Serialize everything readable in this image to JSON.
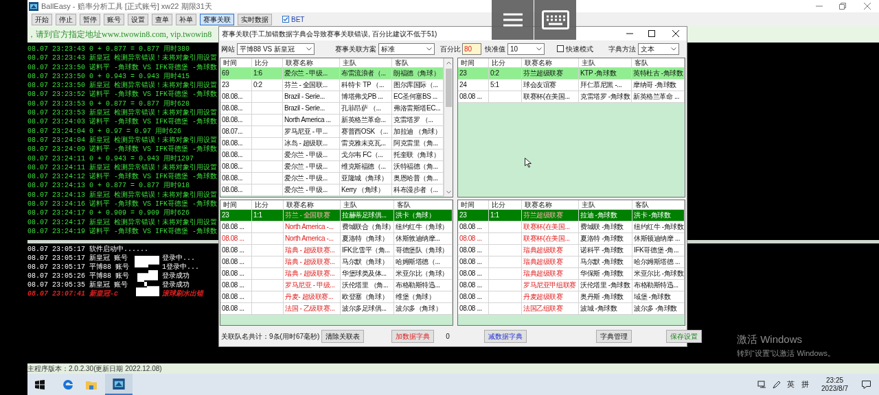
{
  "window": {
    "title": "BallEasy - 赔率分析工具 [正式账号] xw22 期限31天"
  },
  "toolbar": {
    "buttons": [
      {
        "label": "开始",
        "selected": false
      },
      {
        "label": "停止",
        "selected": false
      },
      {
        "label": "暂停",
        "selected": false
      },
      {
        "label": "账号",
        "selected": false
      },
      {
        "label": "设置",
        "selected": false
      },
      {
        "label": "查单",
        "selected": false
      },
      {
        "label": "补单",
        "selected": false
      },
      {
        "label": "赛事关联",
        "selected": true
      },
      {
        "label": "实时数据",
        "selected": false
      }
    ],
    "bet": {
      "label": "BET",
      "checked": true
    }
  },
  "banner": "，请到官方指定地址www.twowin8.com, vip.twowin8",
  "log": [
    "08.07 23:23:43 0 + 0.877 = 0.877 用时380",
    "08.07 23:23:43 新皇冠 检测异常错误！未将对象引用设置",
    "08.07 23:23:50 诺料平 -角球数 VS IFK哥德堡 -角球数",
    "08.07 23:23:50 0 + 0.943 = 0.943 用时415",
    "08.07 23:23:50 新皇冠 检测异常错误！未将对象引用设置",
    "08.07 23:23:52 诺料平 -角球数 VS IFK哥德堡 -角球数",
    "08.07 23:23:53 0 + 0.877 = 0.877 用时628",
    "08.07 23:23:53 新皇冠 检测异常错误！未将对象引用设置",
    "08.07 23:24:03 诺料平 -角球数 VS IFK哥德堡 -角球数",
    "08.07 23:24:04 0 + 0.97 = 0.97 用时626",
    "08.07 23:24:04 新皇冠 检测异常错误！未将对象引用设置",
    "08.07 23:24:09 诺料平 -角球数 VS IFK哥德堡 -角球数",
    "08.07 23:24:11 0 + 0.943 = 0.943 用时1297",
    "08.07 23:24:11 新皇冠 检测异常错误！未将对象引用设置",
    "08.07 23:24:12 诺料平 -角球数 VS IFK哥德堡 -角球数",
    "08.07 23:24:13 0 + 0.877 = 0.877 用时918",
    "08.07 23:24:13 新皇冠 检测异常错误！未将对象引用设置",
    "08.07 23:24:16 诺料平 -角球数 VS IFK哥德堡 -角球数",
    "08.07 23:24:17 0 + 0.909 = 0.909 用时626",
    "08.07 23:24:17 新皇冠 检测异常错误！未将对象引用设置",
    "08.07 23:24:19 诺料平 -角球数 VS IFK哥德堡 -角球数"
  ],
  "events": [
    {
      "kind": "info",
      "text": "08.07 23:05:17 软件启动中......"
    },
    {
      "kind": "redacted",
      "before": "08.07 23:05:17 新皇冠 账号",
      "after": "登录中..."
    },
    {
      "kind": "redacted",
      "before": "08.07 23:05:17 平博88 账号",
      "after": "1登录中..."
    },
    {
      "kind": "redacted",
      "before": "08.07 23:05:26 平博88 账号",
      "after": "登录成功"
    },
    {
      "kind": "redacted",
      "before": "08.07 23:05:35 新皇冠 账号",
      "after": "登录成功"
    },
    {
      "kind": "error",
      "before": "08.07 23:07:41 新皇冠-c",
      "after": "滚球刷水出错"
    }
  ],
  "status_bar": "主程序版本：2.0.2.30(更新日期 2022.12.08)",
  "dialog": {
    "title": "赛事关联(手工加错数据字典会导致赛事关联错误, 百分比建议不低于51)",
    "site": {
      "label": "网站",
      "value": "平博88 VS 新皇冠"
    },
    "scheme": {
      "label": "赛事关联方案",
      "value": "标准"
    },
    "percent": {
      "label": "百分比",
      "value": "80"
    },
    "threshold": {
      "label": "快准值",
      "value": "10"
    },
    "fast_mode": {
      "label": "快速模式",
      "checked": false
    },
    "dict_method": {
      "label": "字典方法",
      "value": "文本"
    },
    "tables": [
      {
        "kind": "candidates",
        "scrollable": true,
        "columns": [
          "时间",
          "比分",
          "联赛名称",
          "主队",
          "客队"
        ],
        "rows": [
          {
            "time": "69",
            "score": "1:6",
            "league": "爱尔兰 - 甲级...",
            "home": "布雷流浪者（...",
            "away": "朗福德（角球）",
            "selected": true,
            "time_flagged": false
          },
          {
            "time": "23",
            "score": "0:2",
            "league": "芬兰 - 全国联...",
            "home": "科特卡 TP （...",
            "away": "图尔库国际（...",
            "selected": false,
            "time_flagged": false
          },
          {
            "time": "08.08...",
            "score": "",
            "league": "Brazil - Serie...",
            "home": "博塔弗戈PB ...",
            "away": "EC圣何塞BS ...",
            "selected": false,
            "time_flagged": false
          },
          {
            "time": "08.08...",
            "score": "",
            "league": "Brazil - Serie...",
            "home": "孔菲昂萨 （...",
            "away": "弗洛雷斯塔EC...",
            "selected": false,
            "time_flagged": false
          },
          {
            "time": "08.08...",
            "score": "",
            "league": "North America ...",
            "home": "新英格兰革命...",
            "away": "克雷塔罗 （...",
            "selected": false,
            "time_flagged": false
          },
          {
            "time": "08.07...",
            "score": "",
            "league": "罗马尼亚 - 甲...",
            "home": "赛普西OSK （...",
            "away": "加拉迪 （角球）",
            "selected": false,
            "time_flagged": false
          },
          {
            "time": "08.08...",
            "score": "",
            "league": "冰岛 - 超级联...",
            "home": "雷克雅未克瓦...",
            "away": "阿克雷里（角...",
            "selected": false,
            "time_flagged": false
          },
          {
            "time": "08.08...",
            "score": "",
            "league": "爱尔兰 - 甲级...",
            "home": "戈尔韦 FC（...",
            "away": "托奎联（角球）",
            "selected": false,
            "time_flagged": false
          },
          {
            "time": "08.08...",
            "score": "",
            "league": "爱尔兰 - 甲级...",
            "home": "维克斯福德（...",
            "away": "沃特福德（角...",
            "selected": false,
            "time_flagged": false
          },
          {
            "time": "08.08...",
            "score": "",
            "league": "爱尔兰 - 甲级...",
            "home": "亚隆城（角球）",
            "away": "奥恩哈普（角...",
            "selected": false,
            "time_flagged": false
          },
          {
            "time": "08.08...",
            "score": "",
            "league": "爱尔兰 - 甲级...",
            "home": "Kerry （角球）",
            "away": "科布漫步者（...",
            "selected": false,
            "time_flagged": false
          }
        ]
      },
      {
        "kind": "candidates",
        "scrollable": false,
        "columns": [
          "时间",
          "比分",
          "联赛名称",
          "主队",
          "客队"
        ],
        "rows": [
          {
            "time": "23",
            "score": "0:2",
            "league": "芬兰超级联赛",
            "home": "KTP -角球数",
            "away": "英特杜古 -角球数",
            "selected": true,
            "time_flagged": false
          },
          {
            "time": "24",
            "score": "5:1",
            "league": "球会友谊赛",
            "home": "拜仁慕尼黑 -...",
            "away": "摩纳哥 -角球数",
            "selected": false,
            "time_flagged": false
          },
          {
            "time": "08.08 ...",
            "score": "",
            "league": "联赛杯(在美国...",
            "home": "克雷塔罗 -角球数",
            "away": "新英格兰革命 ...",
            "selected": false,
            "time_flagged": false
          }
        ]
      },
      {
        "kind": "linked",
        "scrollable": false,
        "columns": [
          "时间",
          "比分",
          "联赛名称",
          "主队",
          "客队"
        ],
        "rows": [
          {
            "time": "23",
            "score": "1:1",
            "league": "芬兰 - 全国联赛",
            "home": "拉赫蒂足球俱...",
            "away": "洪卡（角球）",
            "selected": true,
            "time_flagged": false
          },
          {
            "time": "08.08 ...",
            "score": "",
            "league": "North America -...",
            "home": "费城联合（角球）",
            "away": "纽约红牛（角球）",
            "selected": false,
            "time_flagged": false
          },
          {
            "time": "08.08 ...",
            "score": "",
            "league": "North America -...",
            "home": "夏洛特（角球）",
            "away": "休斯敦迪纳摩...",
            "selected": false,
            "time_flagged": true
          },
          {
            "time": "08.08 ...",
            "score": "",
            "league": "瑞典 - 超级联赛...",
            "home": "IFK北雪平（角...",
            "away": "哥德堡队（角球）",
            "selected": false,
            "time_flagged": false
          },
          {
            "time": "08.08 ...",
            "score": "",
            "league": "瑞典 - 超级联赛...",
            "home": "马尔默（角球）",
            "away": "哈姆斯塔德（...",
            "selected": false,
            "time_flagged": false
          },
          {
            "time": "08.08 ...",
            "score": "",
            "league": "瑞典 - 超级联赛...",
            "home": "华堡球类及体...",
            "away": "米亚尔比（角球）",
            "selected": false,
            "time_flagged": false
          },
          {
            "time": "08.08 ...",
            "score": "",
            "league": "罗马尼亚 - 甲级...",
            "home": "沃伦塔里 （角...",
            "away": "布格勒斯特迅...",
            "selected": false,
            "time_flagged": false
          },
          {
            "time": "08.08 ...",
            "score": "",
            "league": "丹麦- 超级联赛...",
            "home": "欧登塞（角球）",
            "away": "维堡（角球）",
            "selected": false,
            "time_flagged": false
          },
          {
            "time": "08.08 ...",
            "score": "",
            "league": "法国 - 乙级联赛...",
            "home": "波尔多足球俱...",
            "away": "波尔多（角球）",
            "selected": false,
            "time_flagged": false
          }
        ]
      },
      {
        "kind": "linked",
        "scrollable": false,
        "columns": [
          "时间",
          "比分",
          "联赛名称",
          "主队",
          "客队"
        ],
        "rows": [
          {
            "time": "23",
            "score": "1:1",
            "league": "芬兰超级联赛",
            "home": "拉迪 -角球数",
            "away": "洪卡 -角球数",
            "selected": true,
            "time_flagged": false
          },
          {
            "time": "08.08 ...",
            "score": "",
            "league": "联赛杯(在美国...",
            "home": "费城联 -角球数",
            "away": "纽约红牛 -角球数",
            "selected": false,
            "time_flagged": false
          },
          {
            "time": "08.08 ...",
            "score": "",
            "league": "联赛杯(在美国...",
            "home": "夏洛特 -角球数",
            "away": "休斯顿迪纳摩 ...",
            "selected": false,
            "time_flagged": true
          },
          {
            "time": "08.08 ...",
            "score": "",
            "league": "瑞典超级联赛",
            "home": "诺科平 -角球数",
            "away": "IFK哥德堡 -角...",
            "selected": false,
            "time_flagged": false
          },
          {
            "time": "08.08 ...",
            "score": "",
            "league": "瑞典超级联赛",
            "home": "马尔默 -角球数",
            "away": "哈尔姆斯塔德 ...",
            "selected": false,
            "time_flagged": false
          },
          {
            "time": "08.08 ...",
            "score": "",
            "league": "瑞典超级联赛",
            "home": "华保斯 -角球数",
            "away": "米亚尔比 -角球数",
            "selected": false,
            "time_flagged": false
          },
          {
            "time": "08.08 ...",
            "score": "",
            "league": "罗马尼亚甲组联赛",
            "home": "沃伦塔里 -角球数",
            "away": "布格勒斯特迅...",
            "selected": false,
            "time_flagged": false
          },
          {
            "time": "08.08 ...",
            "score": "",
            "league": "丹麦超级联赛",
            "home": "奥丹斯 -角球数",
            "away": "域堡 -角球数",
            "selected": false,
            "time_flagged": false
          },
          {
            "time": "08.08 ...",
            "score": "",
            "league": "法国乙组联赛",
            "home": "波城 -角球数",
            "away": "波尔多 -角球数",
            "selected": false,
            "time_flagged": false
          }
        ]
      }
    ],
    "summary": "关联队名共计：9条(用时67毫秒)",
    "count": "0",
    "buttons": [
      {
        "label": "清除关联表",
        "kind": "plain"
      },
      {
        "label": "加数据字典",
        "kind": "add"
      },
      {
        "label": "减数据字典",
        "kind": "remove"
      },
      {
        "label": "字典管理",
        "kind": "plain"
      },
      {
        "label": "保存设置",
        "kind": "save"
      }
    ]
  },
  "taskbar": {
    "language": "英",
    "input_mode": "拼",
    "time": "23:25",
    "date": "2023/8/7"
  },
  "activation": {
    "title": "激活 Windows",
    "text": "转到“设置”以激活 Windows。"
  }
}
